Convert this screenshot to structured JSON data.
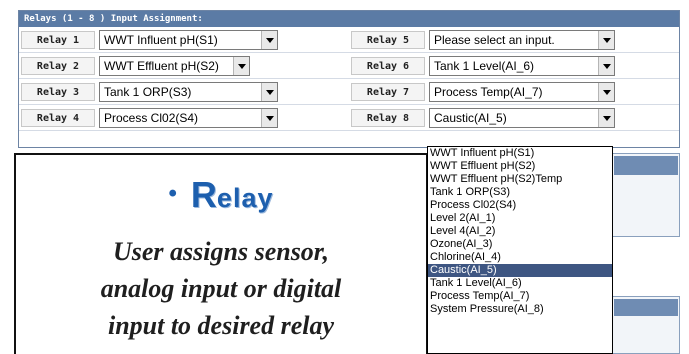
{
  "panel": {
    "header": "Relays (1 - 8 ) Input Assignment:",
    "rows": [
      {
        "left_label": "Relay 1",
        "left_value": "WWT Influent pH(S1)",
        "right_label": "Relay 5",
        "right_value": "Please select an input."
      },
      {
        "left_label": "Relay 2",
        "left_value": "WWT Effluent pH(S2)",
        "right_label": "Relay 6",
        "right_value": "Tank 1 Level(AI_6)"
      },
      {
        "left_label": "Relay 3",
        "left_value": "Tank 1 ORP(S3)",
        "right_label": "Relay 7",
        "right_value": "Process Temp(AI_7)"
      },
      {
        "left_label": "Relay 4",
        "left_value": "Process Cl02(S4)",
        "right_label": "Relay 8",
        "right_value": "Caustic(AI_5)"
      }
    ]
  },
  "callout": {
    "bullet": "•",
    "title_cap": "R",
    "title_rest": "elay",
    "lines": [
      "User assigns sensor,",
      "analog input or digital",
      "input to desired relay"
    ]
  },
  "dropdown": {
    "options": [
      "WWT Influent pH(S1)",
      "WWT Effluent pH(S2)",
      "WWT Effluent pH(S2)Temp",
      "Tank 1 ORP(S3)",
      "Process Cl02(S4)",
      "Level 2(AI_1)",
      "Level 4(AI_2)",
      "Ozone(AI_3)",
      "Chlorine(AI_4)",
      "Caustic(AI_5)",
      "Tank 1 Level(AI_6)",
      "Process Temp(AI_7)",
      "System Pressure(AI_8)"
    ],
    "selected_index": 9
  },
  "colors": {
    "header_bg": "#5b7ba5",
    "title_blue": "#1d5fae",
    "selected_bg": "#3e5682"
  }
}
